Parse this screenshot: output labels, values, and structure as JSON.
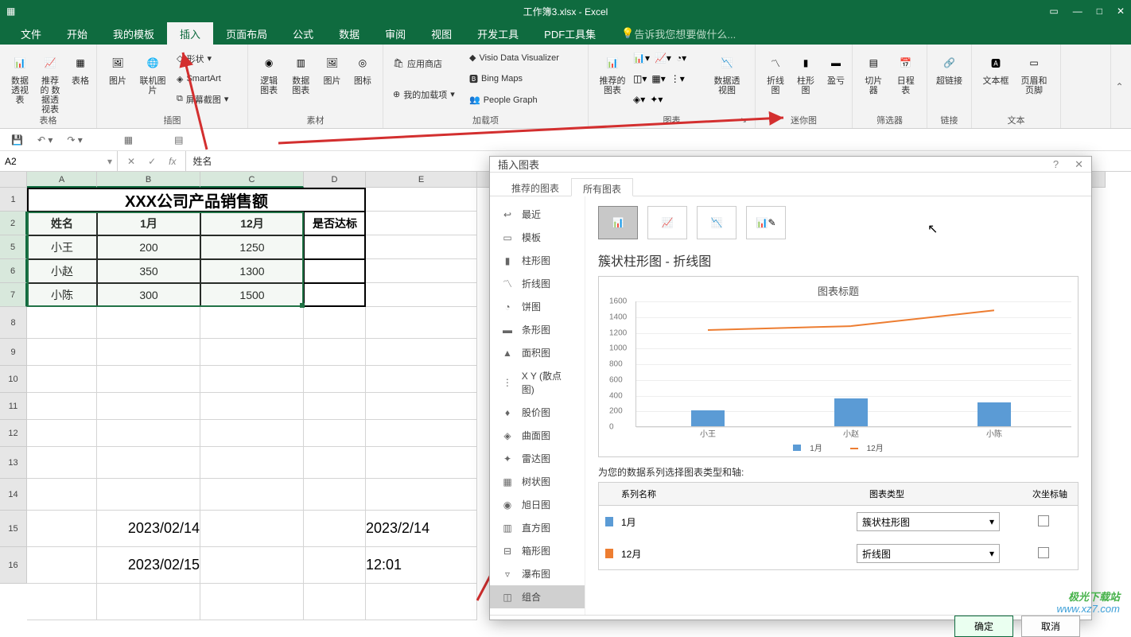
{
  "title": "工作簿3.xlsx - Excel",
  "menu_tabs": [
    "文件",
    "开始",
    "我的模板",
    "插入",
    "页面布局",
    "公式",
    "数据",
    "审阅",
    "视图",
    "开发工具",
    "PDF工具集"
  ],
  "active_menu_tab": "插入",
  "tell_me": "告诉我您想要做什么...",
  "ribbon": {
    "grp_tables": {
      "label": "表格",
      "pivot": "数据\n透视表",
      "rec_pivot": "推荐的\n数据透视表",
      "table": "表格"
    },
    "grp_illus": {
      "label": "插图",
      "pic": "图片",
      "online": "联机图片",
      "shapes": "形状",
      "smartart": "SmartArt",
      "screenshot": "屏幕截图"
    },
    "grp_elements": {
      "label": "素材",
      "logic": "逻辑\n图表",
      "data_chart": "数据\n图表",
      "img": "图片",
      "icon": "图标"
    },
    "grp_addins": {
      "label": "加载项",
      "store": "应用商店",
      "myaddins": "我的加载项",
      "visio": "Visio Data Visualizer",
      "bing": "Bing Maps",
      "people": "People Graph"
    },
    "grp_charts": {
      "label": "图表",
      "rec": "推荐的\n图表",
      "pivot": "数据透视图"
    },
    "grp_spark": {
      "label": "迷你图",
      "line": "折线图",
      "col": "柱形图",
      "winloss": "盈亏"
    },
    "grp_filter": {
      "label": "筛选器",
      "slicer": "切片器",
      "timeline": "日程表"
    },
    "grp_links": {
      "label": "链接",
      "hyper": "超链接"
    },
    "grp_text": {
      "label": "文本",
      "textbox": "文本框",
      "headerfooter": "页眉和页脚"
    }
  },
  "name_box": "A2",
  "formula": "姓名",
  "cols": [
    "A",
    "B",
    "C",
    "D",
    "E"
  ],
  "rows": [
    "1",
    "2",
    "5",
    "6",
    "7",
    "8",
    "9",
    "10",
    "11",
    "12",
    "13",
    "14",
    "15",
    "16"
  ],
  "sheet": {
    "title": "XXX公司产品销售额",
    "headers": [
      "姓名",
      "1月",
      "12月",
      "是否达标"
    ],
    "data": [
      [
        "小王",
        "200",
        "1250",
        ""
      ],
      [
        "小赵",
        "350",
        "1300",
        ""
      ],
      [
        "小陈",
        "300",
        "1500",
        ""
      ]
    ],
    "dates": {
      "d1": "2023/02/14",
      "d2": "2023/2/14",
      "d3": "2023/02/15",
      "d4": "12:01"
    }
  },
  "dialog": {
    "title": "插入图表",
    "tab_rec": "推荐的图表",
    "tab_all": "所有图表",
    "side": [
      "最近",
      "模板",
      "柱形图",
      "折线图",
      "饼图",
      "条形图",
      "面积图",
      "X Y (散点图)",
      "股价图",
      "曲面图",
      "雷达图",
      "树状图",
      "旭日图",
      "直方图",
      "箱形图",
      "瀑布图",
      "组合"
    ],
    "side_active": "组合",
    "chart_type_title": "簇状柱形图 - 折线图",
    "preview_title": "图表标题",
    "legend1": "1月",
    "legend2": "12月",
    "series_prompt": "为您的数据系列选择图表类型和轴:",
    "col_series": "系列名称",
    "col_type": "图表类型",
    "col_axis": "次坐标轴",
    "series": [
      {
        "name": "1月",
        "type": "簇状柱形图",
        "color": "#5b9bd5"
      },
      {
        "name": "12月",
        "type": "折线图",
        "color": "#ed7d31"
      }
    ],
    "ok": "确定",
    "cancel": "取消"
  },
  "chart_data": {
    "type": "combo",
    "title": "图表标题",
    "categories": [
      "小王",
      "小赵",
      "小陈"
    ],
    "series": [
      {
        "name": "1月",
        "type": "bar",
        "values": [
          200,
          350,
          300
        ],
        "color": "#5b9bd5"
      },
      {
        "name": "12月",
        "type": "line",
        "values": [
          1250,
          1300,
          1500
        ],
        "color": "#ed7d31"
      }
    ],
    "ylim": [
      0,
      1600
    ],
    "y_ticks": [
      0,
      200,
      400,
      600,
      800,
      1000,
      1200,
      1400,
      1600
    ]
  },
  "watermark": {
    "l1": "极光下载站",
    "l2": "www.xz7.com"
  }
}
